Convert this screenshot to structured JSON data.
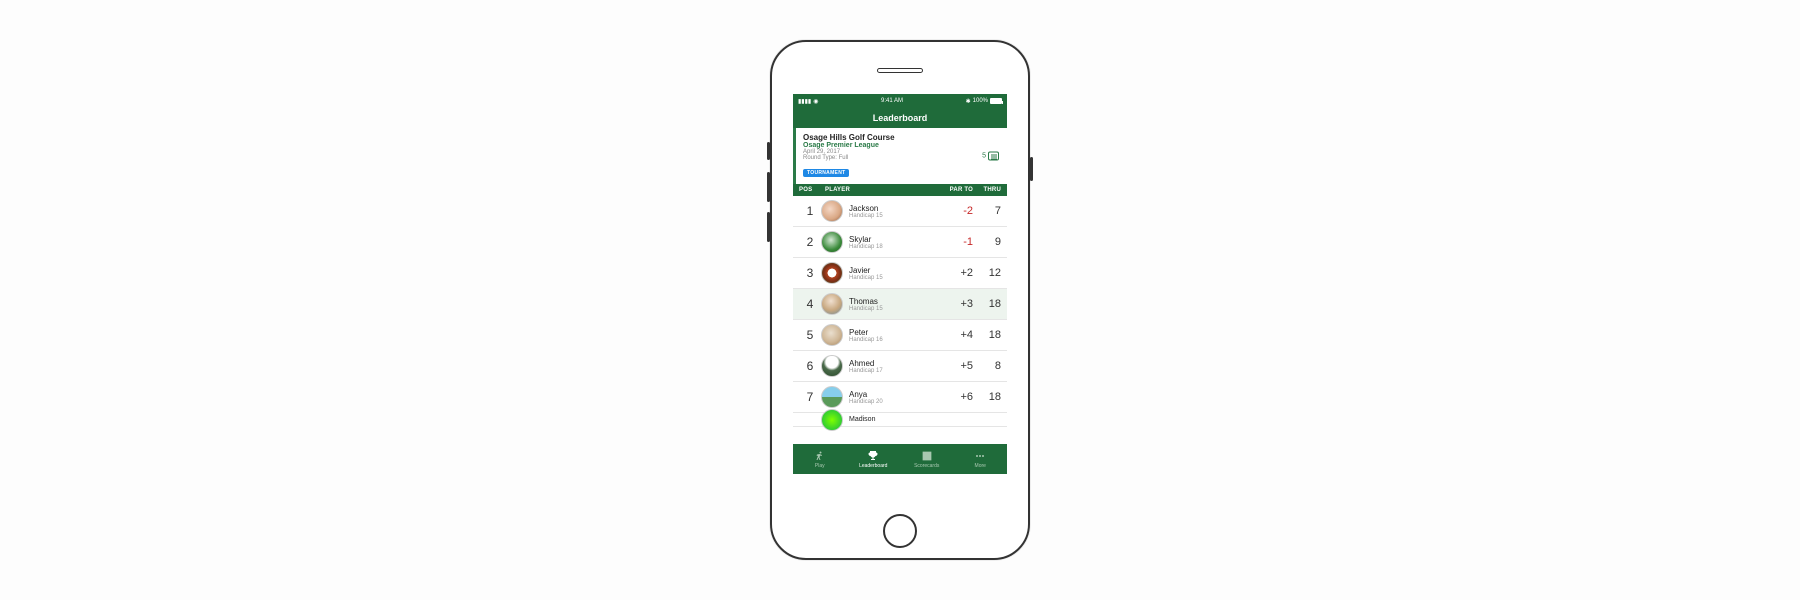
{
  "status": {
    "time": "9:41 AM",
    "battery": "100%",
    "bt": "✱"
  },
  "header": {
    "title": "Leaderboard"
  },
  "info": {
    "course": "Osage Hills Golf Course",
    "league": "Osage Premier League",
    "date": "April 29, 2017",
    "round": "Round Type: Full",
    "badge": "TOURNAMENT",
    "comments": "5"
  },
  "columns": {
    "pos": "POS",
    "player": "PLAYER",
    "par": "PAR TO",
    "thru": "THRU"
  },
  "handicap_prefix": "Handicap ",
  "players": [
    {
      "pos": "1",
      "name": "Jackson",
      "handicap": "15",
      "par": "-2",
      "thru": "7",
      "neg": true,
      "av": "a1"
    },
    {
      "pos": "2",
      "name": "Skylar",
      "handicap": "18",
      "par": "-1",
      "thru": "9",
      "neg": true,
      "av": "a2"
    },
    {
      "pos": "3",
      "name": "Javier",
      "handicap": "15",
      "par": "+2",
      "thru": "12",
      "neg": false,
      "av": "a3"
    },
    {
      "pos": "4",
      "name": "Thomas",
      "handicap": "15",
      "par": "+3",
      "thru": "18",
      "neg": false,
      "av": "a4",
      "highlight": true
    },
    {
      "pos": "5",
      "name": "Peter",
      "handicap": "16",
      "par": "+4",
      "thru": "18",
      "neg": false,
      "av": "a5"
    },
    {
      "pos": "6",
      "name": "Ahmed",
      "handicap": "17",
      "par": "+5",
      "thru": "8",
      "neg": false,
      "av": "a6"
    },
    {
      "pos": "7",
      "name": "Anya",
      "handicap": "20",
      "par": "+6",
      "thru": "18",
      "neg": false,
      "av": "a7"
    },
    {
      "pos": "",
      "name": "Madison",
      "handicap": "",
      "par": "",
      "thru": "",
      "neg": false,
      "av": "a8",
      "cut": true
    }
  ],
  "tabs": {
    "play": "Play",
    "leaderboard": "Leaderboard",
    "scorecards": "Scorecards",
    "more": "More"
  }
}
